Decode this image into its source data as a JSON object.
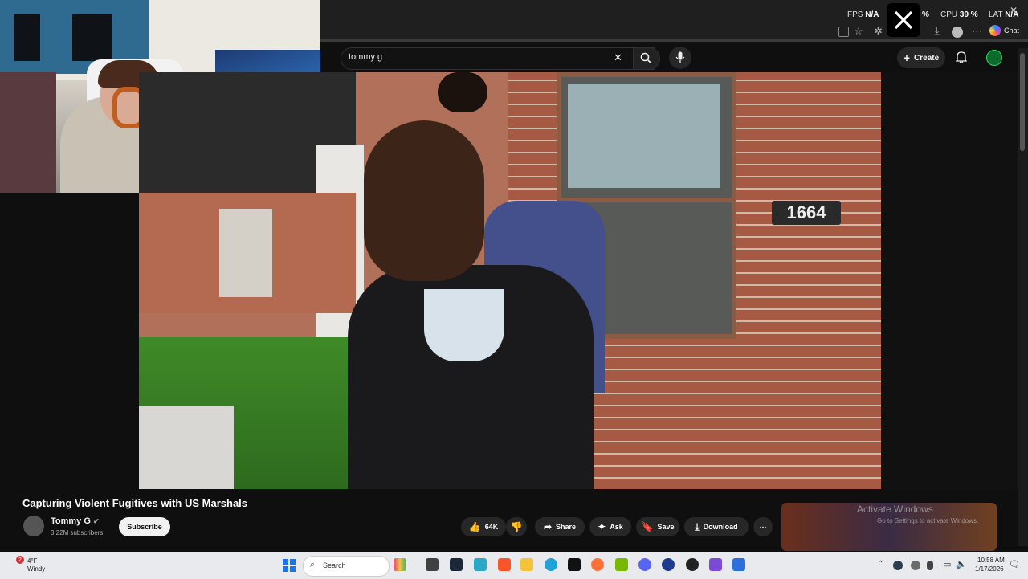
{
  "overlay_stats": {
    "fps_label": "FPS",
    "fps_value": "N/A",
    "gpu_value": "%",
    "cpu_label": "CPU",
    "cpu_value": "39 %",
    "lat_label": "LAT",
    "lat_value": "N/A"
  },
  "browser": {
    "chat_label": "Chat"
  },
  "youtube": {
    "search_value": "tommy g",
    "create_label": "Create"
  },
  "video": {
    "house_number": "1664",
    "title": "Capturing Violent Fugitives with US Marshals",
    "channel_name": "Tommy G",
    "subscribers": "3.22M subscribers",
    "subscribe_label": "Subscribe",
    "likes": "64K",
    "share_label": "Share",
    "ask_label": "Ask",
    "save_label": "Save",
    "download_label": "Download"
  },
  "watermark": {
    "line1": "Activate Windows",
    "line2": "Go to Settings to activate Windows."
  },
  "taskbar": {
    "weather_badge": "2",
    "weather_temp": "4°F",
    "weather_desc": "Windy",
    "search_label": "Search",
    "time": "10:58 AM",
    "date": "1/17/2026"
  }
}
